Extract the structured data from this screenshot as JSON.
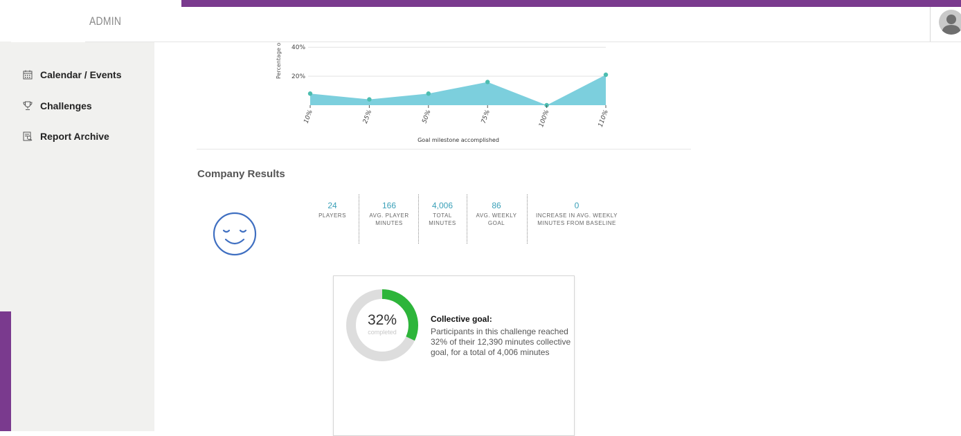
{
  "header": {
    "title": "ADMIN"
  },
  "sidebar": {
    "items": [
      {
        "label": "Calendar / Events",
        "icon": "calendar-icon"
      },
      {
        "label": "Challenges",
        "icon": "trophy-icon"
      },
      {
        "label": "Report Archive",
        "icon": "report-icon"
      }
    ]
  },
  "chart_data": {
    "type": "area",
    "categories": [
      "10%",
      "25%",
      "50%",
      "75%",
      "100%",
      "110%"
    ],
    "values": [
      8,
      4,
      8,
      16,
      0,
      21
    ],
    "xlabel": "Goal milestone accomplished",
    "ylabel": "Percentage o",
    "yticks": [
      "20%",
      "40%"
    ],
    "ylim": [
      0,
      42
    ],
    "grid": true,
    "color": "#7ccfdd",
    "point_color": "#4dbdb0"
  },
  "company_results": {
    "title": "Company Results",
    "mood_icon": "smiley-face-icon",
    "stats": [
      {
        "value": "24",
        "label": "PLAYERS"
      },
      {
        "value": "166",
        "label": "AVG. PLAYER MINUTES"
      },
      {
        "value": "4,006",
        "label": "TOTAL MINUTES"
      },
      {
        "value": "86",
        "label": "AVG. WEEKLY GOAL"
      },
      {
        "value": "0",
        "label": "INCREASE IN AVG. WEEKLY MINUTES FROM BASELINE"
      }
    ]
  },
  "goal_card": {
    "percent_text": "32%",
    "percent_value": 0.32,
    "sub": "completed",
    "title": "Collective goal:",
    "text": "Participants in this challenge reached 32% of their 12,390 minutes collective goal, for a total of 4,006 minutes",
    "progress_color": "#2db53a",
    "track_color": "#dddddd"
  }
}
